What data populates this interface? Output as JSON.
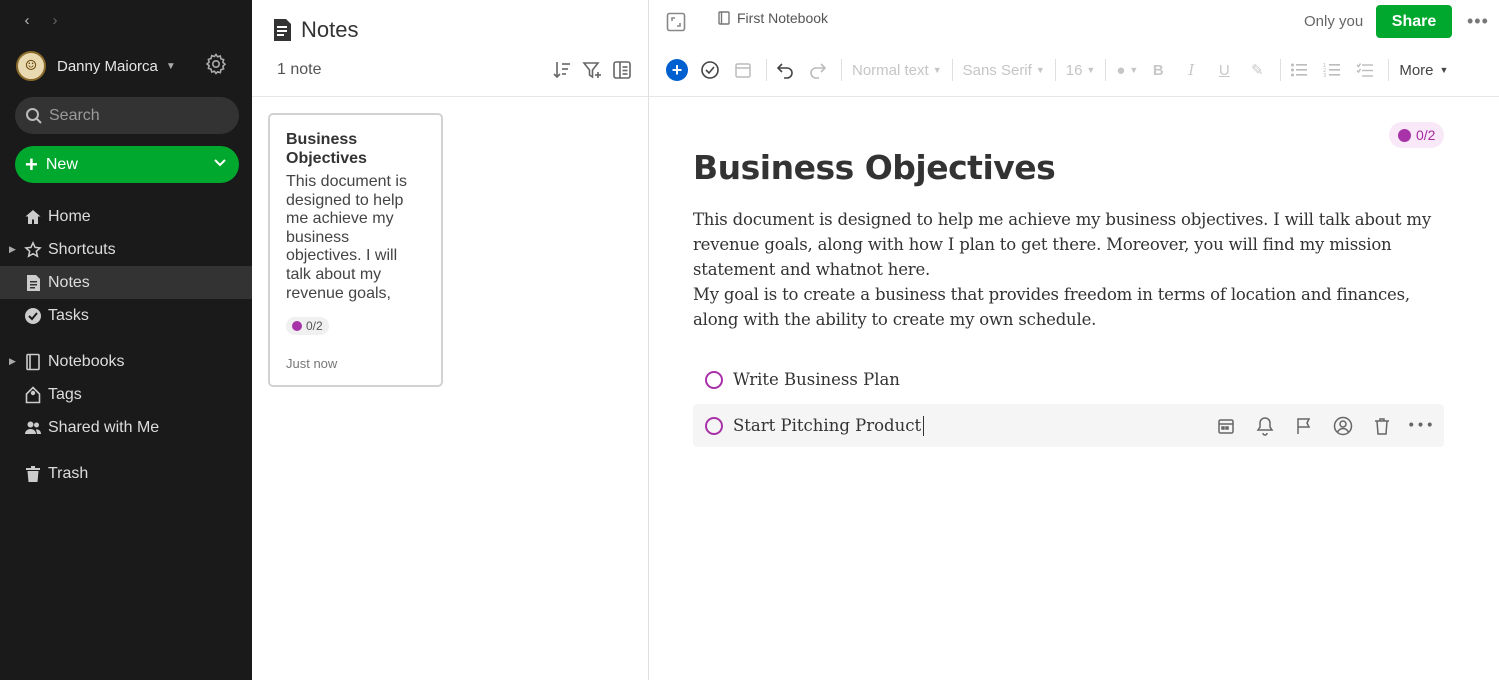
{
  "sidebar": {
    "user_name": "Danny Maiorca",
    "search_placeholder": "Search",
    "new_label": "New",
    "items": [
      {
        "label": "Home"
      },
      {
        "label": "Shortcuts"
      },
      {
        "label": "Notes"
      },
      {
        "label": "Tasks"
      },
      {
        "label": "Notebooks"
      },
      {
        "label": "Tags"
      },
      {
        "label": "Shared with Me"
      },
      {
        "label": "Trash"
      }
    ]
  },
  "note_list": {
    "title": "Notes",
    "count": "1 note",
    "card": {
      "title": "Business Objectives",
      "snippet": "This document is designed to help me achieve my business objectives. I will talk about my revenue goals, along with how I plan to get…",
      "tasks": "0/2",
      "time": "Just now"
    }
  },
  "editor": {
    "notebook": "First Notebook",
    "only_you": "Only you",
    "share": "Share",
    "toolbar": {
      "style": "Normal text",
      "font": "Sans Serif",
      "size": "16",
      "more": "More"
    },
    "task_count": "0/2",
    "title": "Business Objectives",
    "paragraphs": [
      "This document is designed to help me achieve my business objectives. I will talk about my revenue goals, along with how I plan to get there. Moreover, you will find my mission statement and whatnot here.",
      "My goal is to create a business that provides freedom in terms of location and finances, along with the ability to create my own schedule."
    ],
    "tasks": [
      {
        "label": "Write Business Plan"
      },
      {
        "label": "Start Pitching Product"
      }
    ]
  },
  "colors": {
    "sidebar_bg": "#1a1a1a",
    "accent_green": "#00a82d",
    "task_purple": "#a832a8",
    "insert_blue": "#0060d0"
  }
}
